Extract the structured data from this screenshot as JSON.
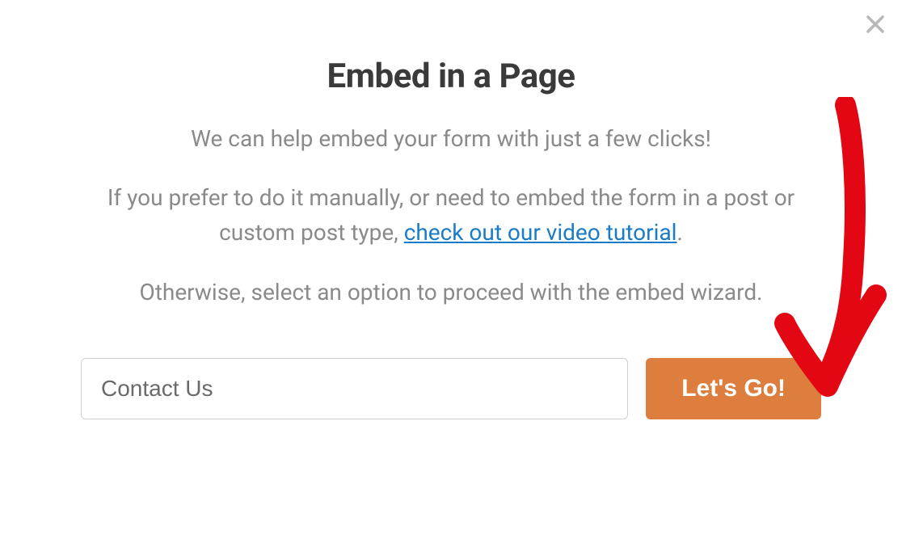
{
  "modal": {
    "title": "Embed in a Page",
    "subtitle": "We can help embed your form with just a few clicks!",
    "paragraph2_before": "If you prefer to do it manually, or need to embed the form in a post or custom post type, ",
    "link_text": "check out our video tutorial",
    "paragraph2_after": ".",
    "paragraph3": "Otherwise, select an option to proceed with the embed wizard.",
    "input_value": "Contact Us",
    "button_label": "Let's Go!"
  }
}
